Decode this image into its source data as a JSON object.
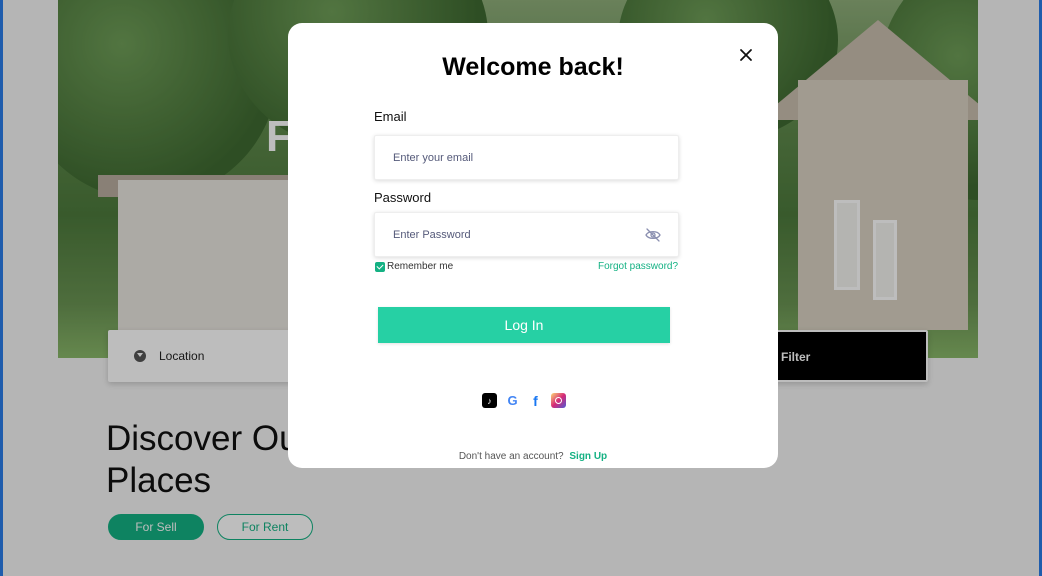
{
  "background": {
    "hero_letter": "F",
    "search": {
      "location_label": "Location",
      "filter_label": "Filter"
    },
    "heading_line1": "Discover Ou",
    "heading_line2": "Places",
    "pills": {
      "sell": "For Sell",
      "rent": "For Rent"
    }
  },
  "modal": {
    "title": "Welcome back!",
    "close_icon": "close-icon",
    "email": {
      "label": "Email",
      "placeholder": "Enter your email"
    },
    "password": {
      "label": "Password",
      "placeholder": "Enter Password",
      "toggle_icon": "eye-off-icon"
    },
    "remember_label": "Remember me",
    "remember_checked": true,
    "forgot_label": "Forgot password?",
    "login_label": "Log In",
    "social_icons": [
      "tiktok-icon",
      "google-icon",
      "facebook-icon",
      "instagram-icon"
    ],
    "signup_prompt": "Don't have an account?",
    "signup_label": "Sign Up"
  },
  "colors": {
    "accent": "#26d0a4",
    "accent_dark": "#14b183",
    "frame": "#2b7de9"
  }
}
